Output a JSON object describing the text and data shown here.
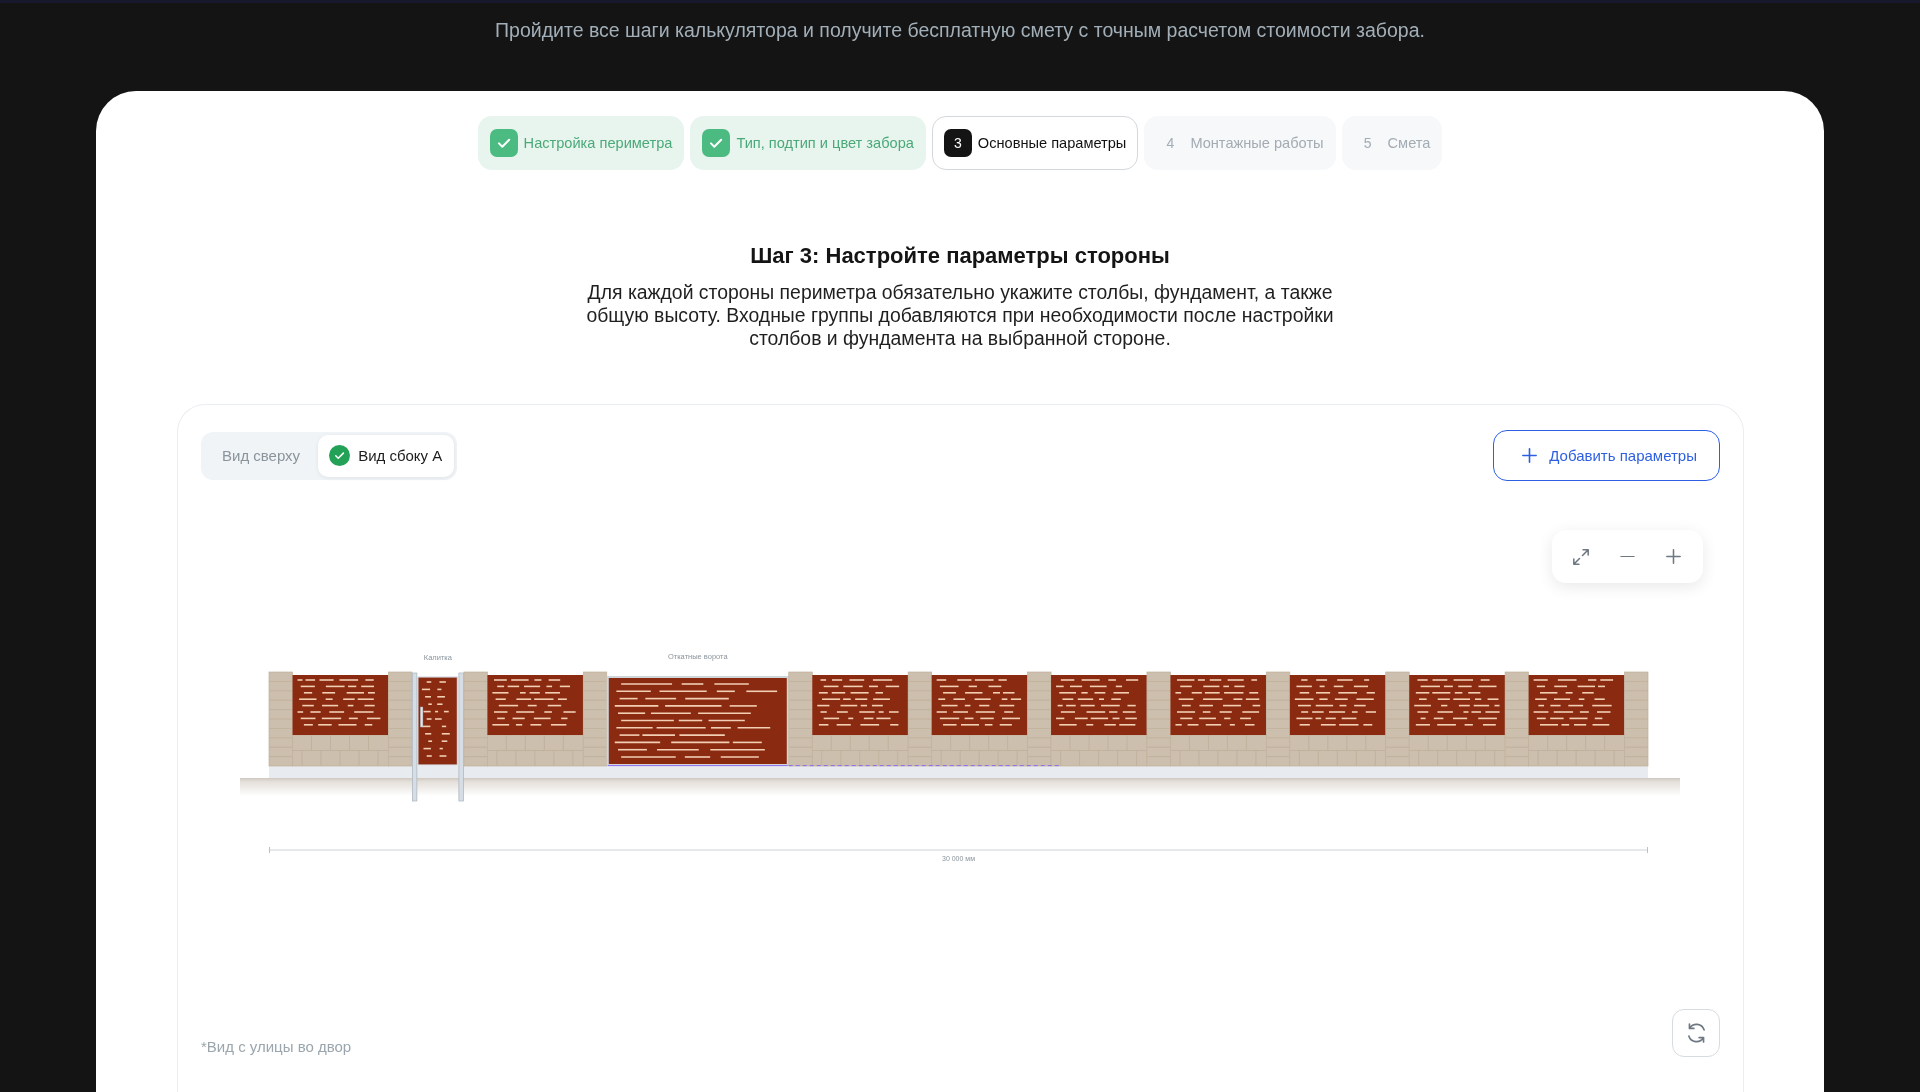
{
  "subtitle": "Пройдите все шаги калькулятора и получите бесплатную смету с точным расчетом стоимости забора.",
  "steps": [
    {
      "label": "Настройка периметра",
      "completed": true,
      "selected": false
    },
    {
      "label": "Тип, подтип и цвет забора",
      "completed": true,
      "selected": false
    },
    {
      "number": "3",
      "label": "Основные параметры",
      "completed": false,
      "selected": true
    },
    {
      "number": "4",
      "label": "Монтажные работы",
      "completed": false,
      "selected": false
    },
    {
      "number": "5",
      "label": "Смета",
      "completed": false,
      "selected": false
    }
  ],
  "heading": "Шаг 3: Настройте параметры стороны",
  "description": "Для каждой стороны периметра обязательно укажите столбы, фундамент, а также общую высоту. Входные группы добавляются при необходимости после настройки столбов и фундамента на выбранной стороне.",
  "view_tabs": [
    {
      "label": "Вид сверху",
      "selected": false,
      "checked": false
    },
    {
      "label": "Вид сбоку А",
      "selected": true,
      "checked": true
    }
  ],
  "add_button": {
    "label": "Добавить параметры"
  },
  "fence": {
    "sections": [
      {
        "kind": "panel"
      },
      {
        "kind": "wicket",
        "label": "Калитка"
      },
      {
        "kind": "panel"
      },
      {
        "kind": "sliding_gate",
        "label": "Откатные ворота"
      },
      {
        "kind": "panel"
      },
      {
        "kind": "panel"
      },
      {
        "kind": "panel"
      },
      {
        "kind": "panel"
      },
      {
        "kind": "panel"
      },
      {
        "kind": "panel"
      },
      {
        "kind": "panel"
      }
    ],
    "dimension": "30 000 мм"
  },
  "footnote": "*Вид с улицы во двор"
}
